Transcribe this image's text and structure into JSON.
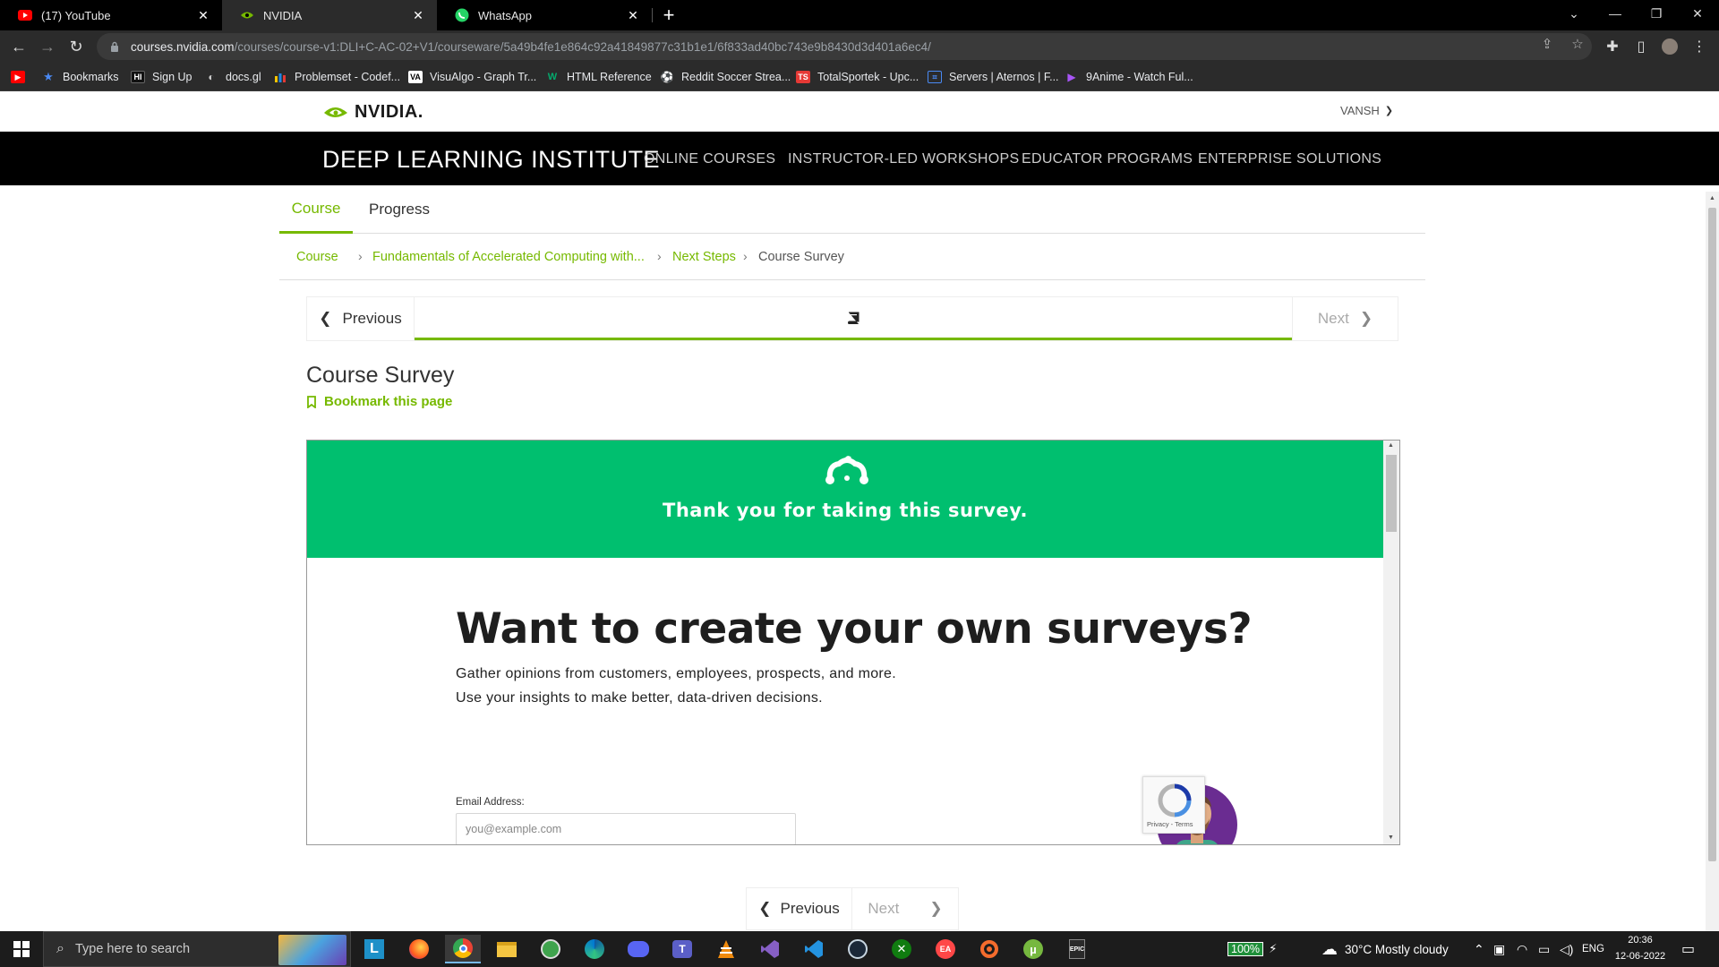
{
  "browser": {
    "tabs": [
      {
        "title": "(17) YouTube",
        "icon": "youtube-icon"
      },
      {
        "title": "NVIDIA",
        "icon": "nvidia-icon"
      },
      {
        "title": "WhatsApp",
        "icon": "whatsapp-icon"
      }
    ],
    "url_host": "courses.nvidia.com",
    "url_path": "/courses/course-v1:DLI+C-AC-02+V1/courseware/5a49b4fe1e864c92a41849877c31b1e1/6f833ad40bc743e9b8430d3d401a6ec4/",
    "bookmarks": [
      {
        "label": "",
        "icon": "youtube-icon"
      },
      {
        "label": "Bookmarks",
        "icon": "star-icon"
      },
      {
        "label": "Sign Up",
        "icon": "hr-icon"
      },
      {
        "label": "docs.gl",
        "icon": "docs-icon"
      },
      {
        "label": "Problemset - Codef...",
        "icon": "codeforces-icon"
      },
      {
        "label": "VisuAlgo - Graph Tr...",
        "icon": "visualgo-icon"
      },
      {
        "label": "HTML Reference",
        "icon": "w3-icon"
      },
      {
        "label": "Reddit Soccer Strea...",
        "icon": "reddit-icon"
      },
      {
        "label": "TotalSportek - Upc...",
        "icon": "ts-icon"
      },
      {
        "label": "Servers | Aternos | F...",
        "icon": "aternos-icon"
      },
      {
        "label": "9Anime - Watch Ful...",
        "icon": "play-icon"
      }
    ]
  },
  "site": {
    "logo_text": "NVIDIA.",
    "user_name": "VANSH",
    "dli_title": "DEEP LEARNING INSTITUTE",
    "nav": [
      "ONLINE COURSES",
      "INSTRUCTOR-LED WORKSHOPS",
      "EDUCATOR PROGRAMS",
      "ENTERPRISE SOLUTIONS"
    ],
    "course_tabs": [
      "Course",
      "Progress"
    ],
    "breadcrumb": [
      "Course",
      "Fundamentals of Accelerated Computing with...",
      "Next Steps",
      "Course Survey"
    ],
    "seq_prev": "Previous",
    "seq_next": "Next",
    "unit_title": "Course Survey",
    "bookmark_label": "Bookmark this page"
  },
  "survey": {
    "thanks": "Thank you for taking this survey.",
    "headline": "Want to create your own surveys?",
    "line1": "Gather opinions from customers, employees, prospects, and more.",
    "line2": "Use your insights to make better, data-driven decisions.",
    "email_label": "Email Address:",
    "email_placeholder": "you@example.com",
    "recaptcha_text": "Privacy - Terms"
  },
  "taskbar": {
    "search_placeholder": "Type here to search",
    "battery": "100%",
    "weather": "30°C  Mostly cloudy",
    "lang": "ENG",
    "time": "20:36",
    "date": "12-06-2022"
  },
  "colors": {
    "nvidia_green": "#76b900",
    "survey_green": "#00bf6f"
  }
}
